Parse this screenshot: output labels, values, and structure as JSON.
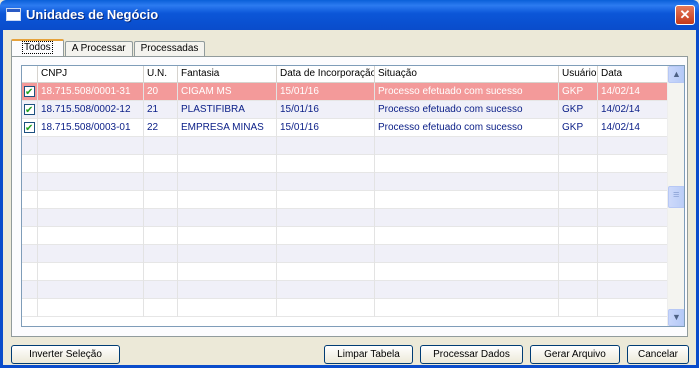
{
  "window": {
    "title": "Unidades de Negócio",
    "close_glyph": "✕"
  },
  "tabs": [
    {
      "label": "Todos",
      "active": true
    },
    {
      "label": "A Processar",
      "active": false
    },
    {
      "label": "Processadas",
      "active": false
    }
  ],
  "grid": {
    "columns": [
      "CNPJ",
      "U.N.",
      "Fantasia",
      "Data de Incorporação",
      "Situação",
      "Usuário",
      "Data"
    ],
    "rows": [
      {
        "checked": true,
        "cnpj": "18.715.508/0001-31",
        "un": "20",
        "fantasia": "CIGAM MS",
        "data_incorporacao": "15/01/16",
        "situacao": "Processo efetuado com sucesso",
        "usuario": "GKP",
        "data": "14/02/14",
        "selected": true
      },
      {
        "checked": true,
        "cnpj": "18.715.508/0002-12",
        "un": "21",
        "fantasia": "PLASTIFIBRA",
        "data_incorporacao": "15/01/16",
        "situacao": "Processo efetuado com sucesso",
        "usuario": "GKP",
        "data": "14/02/14",
        "selected": false
      },
      {
        "checked": true,
        "cnpj": "18.715.508/0003-01",
        "un": "22",
        "fantasia": "EMPRESA MINAS",
        "data_incorporacao": "15/01/16",
        "situacao": "Processo efetuado com sucesso",
        "usuario": "GKP",
        "data": "14/02/14",
        "selected": false
      }
    ],
    "empty_rows": 10
  },
  "scrollbar": {
    "up_glyph": "▲",
    "down_glyph": "▼"
  },
  "buttons": {
    "inverter": "Inverter Seleção",
    "limpar": "Limpar Tabela",
    "processar": "Processar Dados",
    "gerar": "Gerar Arquivo",
    "cancelar": "Cancelar"
  },
  "colors": {
    "selected_row": "#F39A9A",
    "title_bar": "#0A4CCB",
    "row_text": "#0A1E87"
  }
}
